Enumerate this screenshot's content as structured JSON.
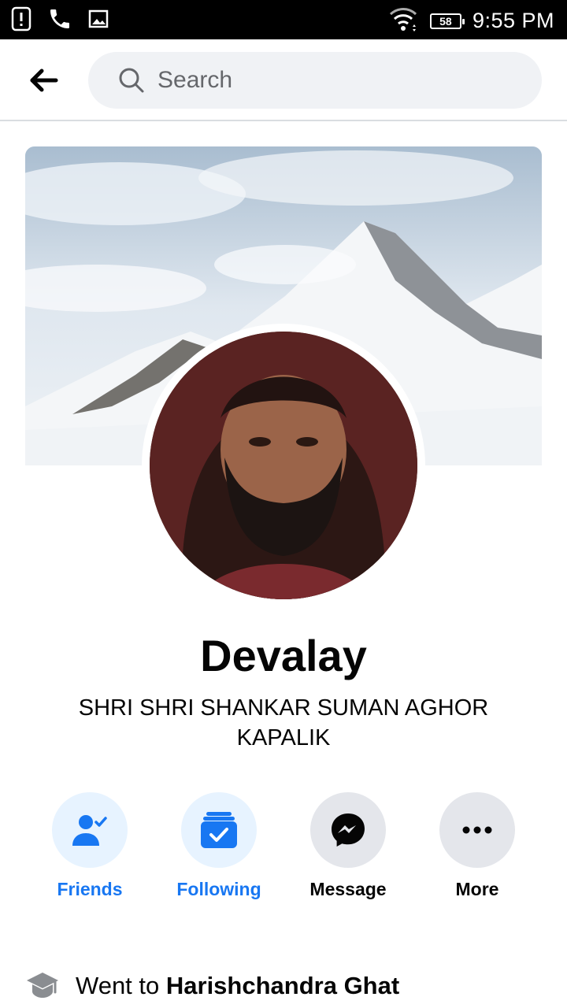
{
  "status_bar": {
    "time": "9:55 PM",
    "battery": "58",
    "icons": [
      "alert-icon",
      "phone-icon",
      "image-icon",
      "wifi-icon",
      "battery-icon"
    ]
  },
  "header": {
    "back_icon": "back-arrow-icon",
    "search_placeholder": "Search"
  },
  "profile": {
    "name": "Devalay",
    "subtitle": "SHRI SHRI SHANKAR SUMAN AGHOR KAPALIK"
  },
  "actions": [
    {
      "label": "Friends",
      "icon": "friends-icon",
      "style": "blue"
    },
    {
      "label": "Following",
      "icon": "following-icon",
      "style": "blue"
    },
    {
      "label": "Message",
      "icon": "messenger-icon",
      "style": "gray"
    },
    {
      "label": "More",
      "icon": "more-icon",
      "style": "gray"
    }
  ],
  "intro": {
    "icon": "graduation-cap-icon",
    "prefix": "Went to ",
    "place": "Harishchandra Ghat"
  },
  "colors": {
    "accent": "#1877f2",
    "accent_bg": "#e7f3ff",
    "neutral_bg": "#e4e6eb",
    "search_bg": "#f0f2f5",
    "muted_text": "#65676b"
  }
}
